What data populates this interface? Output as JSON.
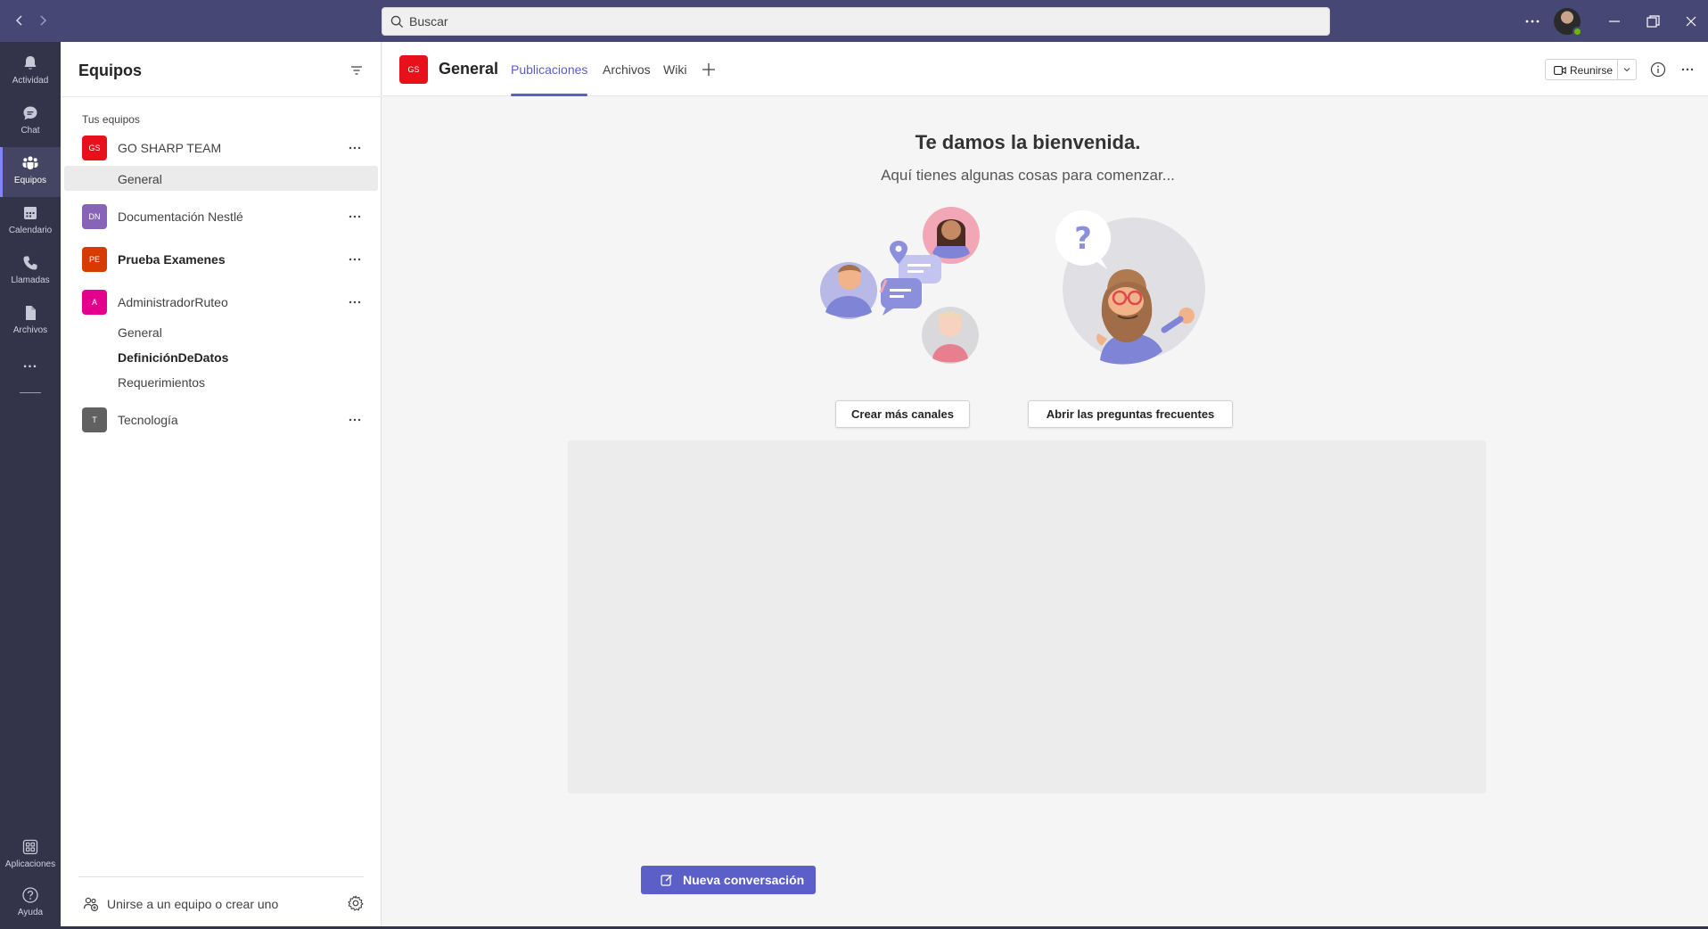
{
  "titlebar": {
    "search_placeholder": "Buscar",
    "accent_color": "#464775"
  },
  "rail": {
    "items": [
      {
        "label": "Actividad",
        "icon": "bell-icon"
      },
      {
        "label": "Chat",
        "icon": "chat-icon"
      },
      {
        "label": "Equipos",
        "icon": "teams-icon",
        "active": true
      },
      {
        "label": "Calendario",
        "icon": "calendar-icon"
      },
      {
        "label": "Llamadas",
        "icon": "phone-icon"
      },
      {
        "label": "Archivos",
        "icon": "file-icon"
      }
    ],
    "more": "...",
    "apps": {
      "label": "Aplicaciones",
      "icon": "apps-icon"
    },
    "help": {
      "label": "Ayuda",
      "icon": "help-icon"
    }
  },
  "panel": {
    "title": "Equipos",
    "section_label": "Tus equipos",
    "teams": [
      {
        "initials": "GS",
        "name": "GO SHARP TEAM",
        "color": "#e8101b",
        "bold": false,
        "channels": [
          {
            "name": "General",
            "selected": true
          }
        ]
      },
      {
        "initials": "DN",
        "name": "Documentación Nestlé",
        "color": "#8764b8",
        "bold": false,
        "channels": []
      },
      {
        "initials": "PE",
        "name": "Prueba Examenes",
        "color": "#d83b01",
        "bold": true,
        "channels": []
      },
      {
        "initials": "A",
        "name": "AdministradorRuteo",
        "color": "#e3008c",
        "bold": false,
        "channels": [
          {
            "name": "General"
          },
          {
            "name": "DefiniciónDeDatos",
            "bold": true
          },
          {
            "name": "Requerimientos"
          }
        ]
      },
      {
        "initials": "T",
        "name": "Tecnología",
        "color": "#616161",
        "bold": false,
        "channels": []
      }
    ],
    "join_label": "Unirse a un equipo o crear uno"
  },
  "main": {
    "channel_badge": "GS",
    "channel_title": "General",
    "tabs": [
      {
        "label": "Publicaciones",
        "active": true
      },
      {
        "label": "Archivos"
      },
      {
        "label": "Wiki"
      }
    ],
    "meet_label": "Reunirse",
    "welcome_title": "Te damos la bienvenida.",
    "welcome_subtitle": "Aquí tienes algunas cosas para comenzar...",
    "cta_channels": "Crear más canales",
    "cta_faq": "Abrir las preguntas frecuentes",
    "new_conversation": "Nueva conversación",
    "brand_color": "#5b5fc7"
  }
}
